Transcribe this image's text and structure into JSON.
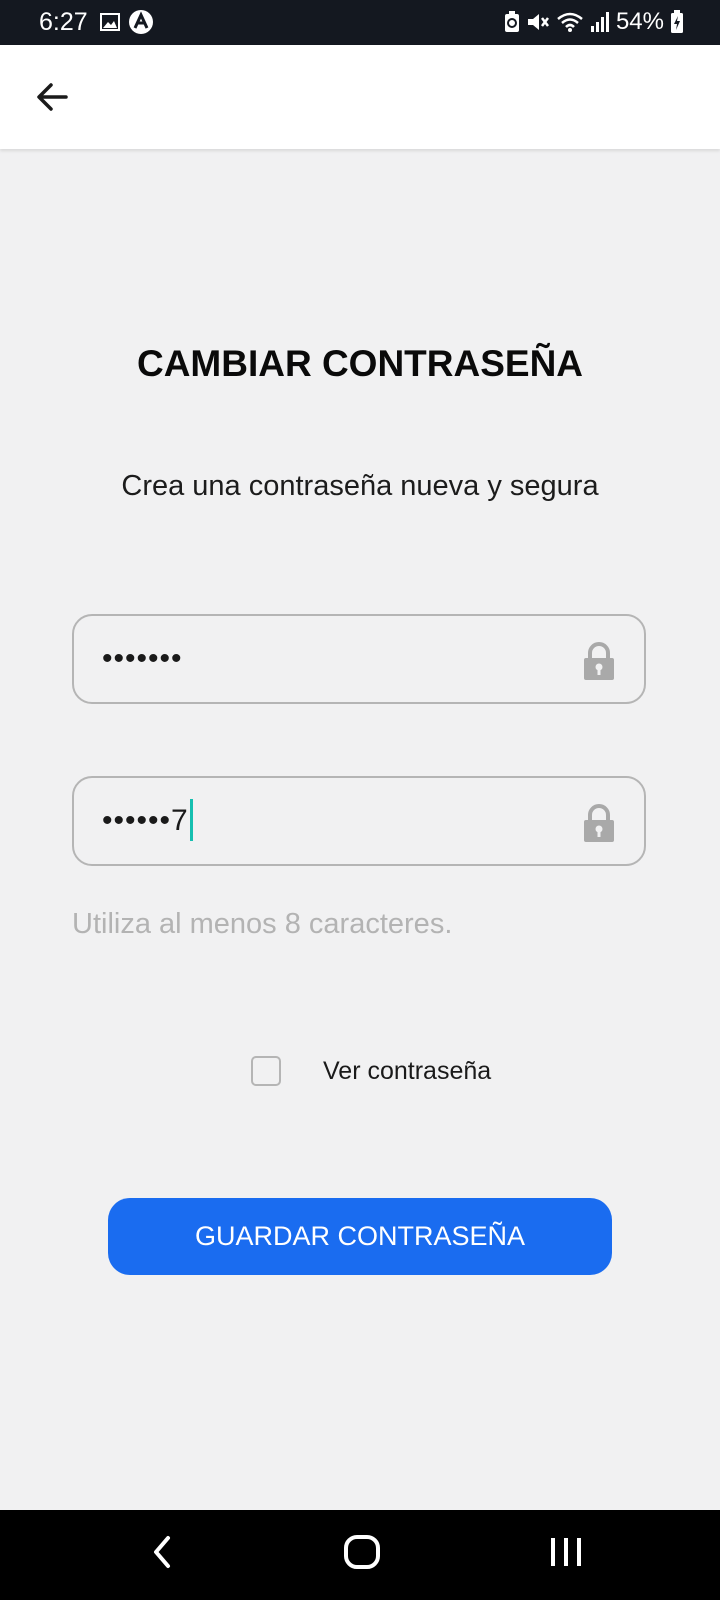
{
  "status_bar": {
    "time": "6:27",
    "battery_percent": "54%",
    "left_icons": [
      "image-icon",
      "notification-app-icon"
    ],
    "right_icons": [
      "battery-saver-icon",
      "mute-icon",
      "wifi-icon",
      "signal-icon",
      "battery-charging-icon"
    ]
  },
  "app_bar": {
    "back_icon": "back-arrow-icon"
  },
  "page": {
    "title": "CAMBIAR CONTRASEÑA",
    "subtitle": "Crea una contraseña nueva y segura",
    "password_field": {
      "value": "•••••••",
      "icon": "lock-icon"
    },
    "confirm_field": {
      "value": "••••••7",
      "icon": "lock-icon"
    },
    "hint": "Utiliza al menos 8 caracteres.",
    "show_password": {
      "label": "Ver contraseña",
      "checked": false
    },
    "save_button": {
      "label": "GUARDAR CONTRASEÑA"
    }
  },
  "colors": {
    "status_bar_bg": "#141820",
    "background": "#f1f1f2",
    "primary": "#1a6cf0",
    "caret": "#16bfb0",
    "field_border": "#b5b5b5",
    "hint_text": "#b3b3b3"
  },
  "nav_bar": {
    "buttons": [
      "nav-back-icon",
      "nav-home-icon",
      "nav-recents-icon"
    ]
  }
}
